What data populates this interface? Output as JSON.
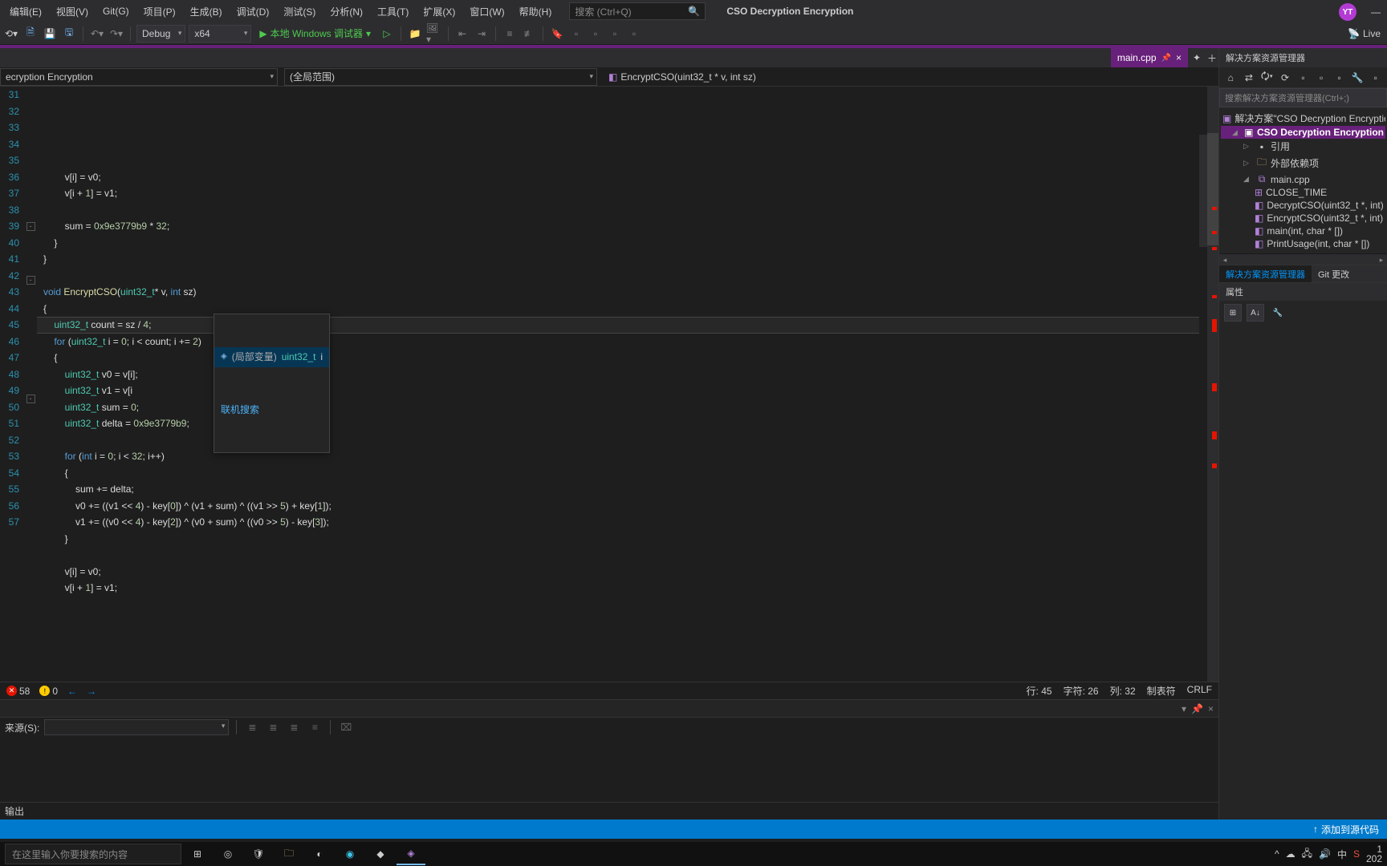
{
  "menu": [
    "编辑(E)",
    "视图(V)",
    "Git(G)",
    "项目(P)",
    "生成(B)",
    "调试(D)",
    "测试(S)",
    "分析(N)",
    "工具(T)",
    "扩展(X)",
    "窗口(W)",
    "帮助(H)"
  ],
  "search_placeholder": "搜索 (Ctrl+Q)",
  "app_title": "CSO Decryption Encryption",
  "avatar": "YT",
  "toolbar": {
    "config": "Debug",
    "platform": "x64",
    "run": "本地 Windows 调试器",
    "live": "Live"
  },
  "tab": {
    "name": "main.cpp"
  },
  "crumbs": {
    "left": "ecryption Encryption",
    "mid": "(全局范围)",
    "func": "EncryptCSO(uint32_t * v, int sz)"
  },
  "lines_start": 31,
  "code_lines": [
    {
      "n": 31,
      "t": ""
    },
    {
      "n": 32,
      "t": "        v[i] = v0;"
    },
    {
      "n": 33,
      "t": "        v[i + 1] = v1;"
    },
    {
      "n": 34,
      "t": ""
    },
    {
      "n": 35,
      "t": "        sum = 0x9e3779b9 * 32;"
    },
    {
      "n": 36,
      "t": "    }"
    },
    {
      "n": 37,
      "t": "}"
    },
    {
      "n": 38,
      "t": ""
    },
    {
      "n": 39,
      "t": "void EncryptCSO(uint32_t* v, int sz)"
    },
    {
      "n": 40,
      "t": "{"
    },
    {
      "n": 41,
      "t": "    uint32_t count = sz / 4;"
    },
    {
      "n": 42,
      "t": "    for (uint32_t i = 0; i < count; i += 2)"
    },
    {
      "n": 43,
      "t": "    {"
    },
    {
      "n": 44,
      "t": "        uint32_t v0 = v[i];"
    },
    {
      "n": 45,
      "t": "        uint32_t v1 = v[i"
    },
    {
      "n": 46,
      "t": "        uint32_t sum = 0;"
    },
    {
      "n": 47,
      "t": "        uint32_t delta = 0x9e3779b9;"
    },
    {
      "n": 48,
      "t": ""
    },
    {
      "n": 49,
      "t": "        for (int i = 0; i < 32; i++)"
    },
    {
      "n": 50,
      "t": "        {"
    },
    {
      "n": 51,
      "t": "            sum += delta;"
    },
    {
      "n": 52,
      "t": "            v0 += ((v1 << 4) - key[0]) ^ (v1 + sum) ^ ((v1 >> 5) + key[1]);"
    },
    {
      "n": 53,
      "t": "            v1 += ((v0 << 4) - key[2]) ^ (v0 + sum) ^ ((v0 >> 5) - key[3]);"
    },
    {
      "n": 54,
      "t": "        }"
    },
    {
      "n": 55,
      "t": ""
    },
    {
      "n": 56,
      "t": "        v[i] = v0;"
    },
    {
      "n": 57,
      "t": "        v[i + 1] = v1;"
    }
  ],
  "intellisense": {
    "category": "(局部变量)",
    "type": "uint32_t",
    "name": "i",
    "link": "联机搜索"
  },
  "status": {
    "errors": "58",
    "warnings": "0",
    "line": "行: 45",
    "char": "字符: 26",
    "col": "列: 32",
    "tabs": "制表符",
    "eol": "CRLF"
  },
  "output": {
    "source_label": "来源(S):",
    "footer": "输出"
  },
  "solution": {
    "title": "解决方案资源管理器",
    "search": "搜索解决方案资源管理器(Ctrl+;)",
    "root": "解决方案\"CSO Decryption Encryption\"(",
    "project": "CSO Decryption Encryption",
    "refs": "引用",
    "ext": "外部依赖项",
    "file": "main.cpp",
    "funcs": [
      "CLOSE_TIME",
      "DecryptCSO(uint32_t *, int)",
      "EncryptCSO(uint32_t *, int)",
      "main(int, char * [])",
      "PrintUsage(int, char * [])"
    ],
    "tab_sol": "解决方案资源管理器",
    "tab_git": "Git 更改",
    "props": "属性"
  },
  "bluebar": {
    "addsrc": "添加到源代码"
  },
  "taskbar": {
    "search": "在这里输入你要搜索的内容",
    "time": "1",
    "date": "202"
  }
}
